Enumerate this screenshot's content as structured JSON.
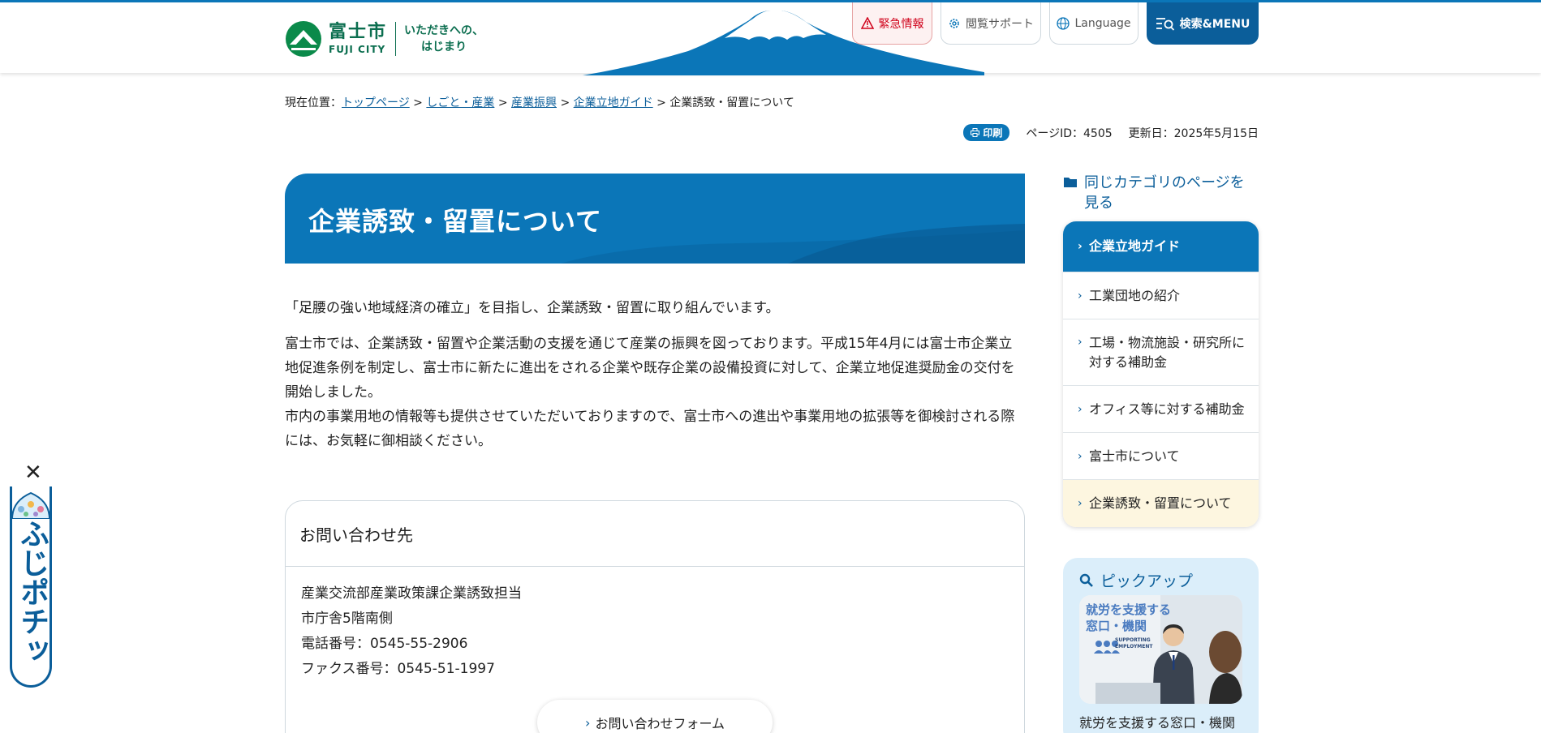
{
  "header": {
    "logo_jp": "富士市",
    "logo_en": "FUJI CITY",
    "slogan_line1": "いただきへの、",
    "slogan_line2": "はじまり",
    "emergency": "緊急情報",
    "reading_support": "閲覧サポート",
    "language": "Language",
    "search_menu": "検索&MENU"
  },
  "breadcrumb": {
    "prefix": "現在位置：",
    "items": [
      "トップページ",
      "しごと・産業",
      "産業振興",
      "企業立地ガイド"
    ],
    "separator": " > ",
    "current": "企業誘致・留置について"
  },
  "meta": {
    "print": "印刷",
    "page_id": "ページID：4505",
    "updated": "更新日：2025年5月15日"
  },
  "page": {
    "title": "企業誘致・留置について",
    "lead": "「足腰の強い地域経済の確立」を目指し、企業誘致・留置に取り組んでいます。",
    "body1": "富士市では、企業誘致・留置や企業活動の支援を通じて産業の振興を図っております。平成15年4月には富士市企業立地促進条例を制定し、富士市に新たに進出をされる企業や既存企業の設備投資に対して、企業立地促進奨励金の交付を開始しました。",
    "body2": "市内の事業用地の情報等も提供させていただいておりますので、富士市への進出や事業用地の拡張等を御検討される際には、お気軽に御相談ください。"
  },
  "contact": {
    "heading": "お問い合わせ先",
    "department": "産業交流部産業政策課企業誘致担当",
    "location": "市庁舎5階南側",
    "phone": "電話番号：0545-55-2906",
    "fax": "ファクス番号：0545-51-1997",
    "form_button": "お問い合わせフォーム"
  },
  "sidebar": {
    "heading_line1": "同じカテゴリのページを",
    "heading_line2": "見る",
    "items": [
      {
        "label": "企業立地ガイド"
      },
      {
        "label": "工業団地の紹介"
      },
      {
        "label": "工場・物流施設・研究所に対する補助金"
      },
      {
        "label": "オフィス等に対する補助金"
      },
      {
        "label": "富士市について"
      },
      {
        "label": "企業誘致・留置について"
      }
    ]
  },
  "pickup": {
    "heading": "ピックアップ",
    "image_text_line1": "就労を支援する",
    "image_text_line2": "窓口・機関",
    "image_text_en1": "SUPPORTING",
    "image_text_en2": "EMPLOYMENT",
    "caption": "就労を支援する窓口・機関"
  },
  "fujipochi": {
    "label": "ふじポチッ",
    "close": "✕"
  },
  "colors": {
    "brand_blue": "#0b76b8",
    "dark_blue": "#0b5e9a",
    "logo_green": "#0b6e4f",
    "alert_red": "#d0021b"
  }
}
